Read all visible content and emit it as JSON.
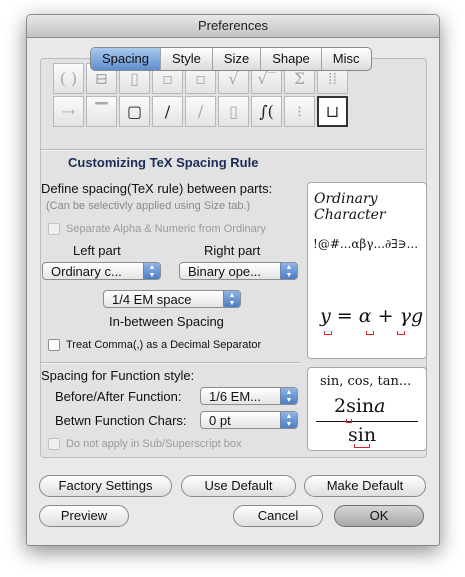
{
  "window": {
    "title": "Preferences"
  },
  "tabs": [
    "Spacing",
    "Style",
    "Size",
    "Shape",
    "Misc"
  ],
  "icons": {
    "row1": [
      "( )",
      "⊟",
      "▯",
      "▫",
      "√",
      "√‾",
      "Σ",
      "⁞⁞"
    ],
    "row2": [
      "⇢",
      "▔",
      "▢",
      "/",
      "∕",
      "▯",
      "∫(",
      "⁝",
      "⊔"
    ]
  },
  "heading": "Customizing TeX Spacing Rule",
  "define_label": "Define spacing(TeX rule) between parts:",
  "hint": "(Can be selectivly applied using Size tab.)",
  "separate_alpha": "Separate Alpha & Numeric from Ordinary",
  "left_part_label": "Left part",
  "right_part_label": "Right part",
  "left_part_value": "Ordinary c...",
  "right_part_value": "Binary ope...",
  "spacing_value": "1/4 EM space",
  "in_between_label": "In-between Spacing",
  "treat_comma": "Treat Comma(,) as a Decimal Separator",
  "preview1": {
    "title1": "Ordinary",
    "title2": "Character",
    "chars": "!@#...αβγ...∂∃∋...",
    "eq": {
      "y": "y",
      "eq": "=",
      "a": "α",
      "plus": "+",
      "gamma": "γ",
      "g": "g"
    }
  },
  "function_style_label": "Spacing for Function style:",
  "before_after_label": "Before/After Function:",
  "before_after_value": "1/6 EM...",
  "betwn_label": "Betwn Function Chars:",
  "betwn_value": "0 pt",
  "no_sub": "Do not apply in Sub/Superscript box",
  "preview2": {
    "funcs": "sin, cos, tan...",
    "num_coef": "2",
    "num_fn": "sin",
    "num_var": "a",
    "den": "sin"
  },
  "buttons": {
    "factory": "Factory Settings",
    "use_default": "Use Default",
    "make_default": "Make Default",
    "preview": "Preview",
    "cancel": "Cancel",
    "ok": "OK"
  },
  "colors": {
    "heading": "#1b2d57",
    "selected_tab": "#5e8ed0",
    "marker": "#dd2222"
  }
}
